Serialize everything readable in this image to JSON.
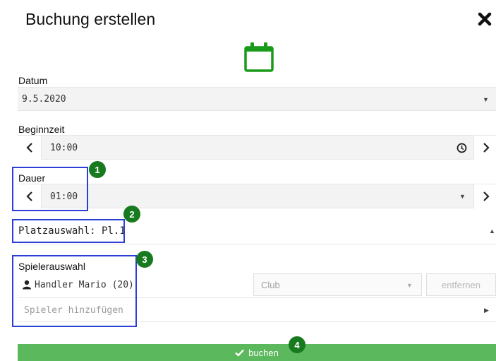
{
  "dialog": {
    "title": "Buchung erstellen",
    "close_icon": "close-icon",
    "calendar_icon": "calendar-icon",
    "accent_color": "#1a9a1a"
  },
  "datum": {
    "label": "Datum",
    "value": "9.5.2020"
  },
  "beginnzeit": {
    "label": "Beginnzeit",
    "value": "10:00",
    "prev_icon": "chevron-left-icon",
    "next_icon": "chevron-right-icon",
    "clock_icon": "clock-icon"
  },
  "dauer": {
    "label": "Dauer",
    "value": "01:00"
  },
  "platz": {
    "label": "Platzauswahl: Pl.1"
  },
  "spieler": {
    "label": "Spielerauswahl",
    "player_name": "Handler Mario (20)",
    "club_select": "Club",
    "remove_label": "entfernen",
    "add_placeholder": "Spieler hinzufügen"
  },
  "book": {
    "label": "buchen",
    "color": "#5cb85c"
  },
  "annotations": {
    "badge_1": "1",
    "badge_2": "2",
    "badge_3": "3",
    "badge_4": "4",
    "badge_color": "#187a1e",
    "box_color": "#2b3fd6"
  }
}
